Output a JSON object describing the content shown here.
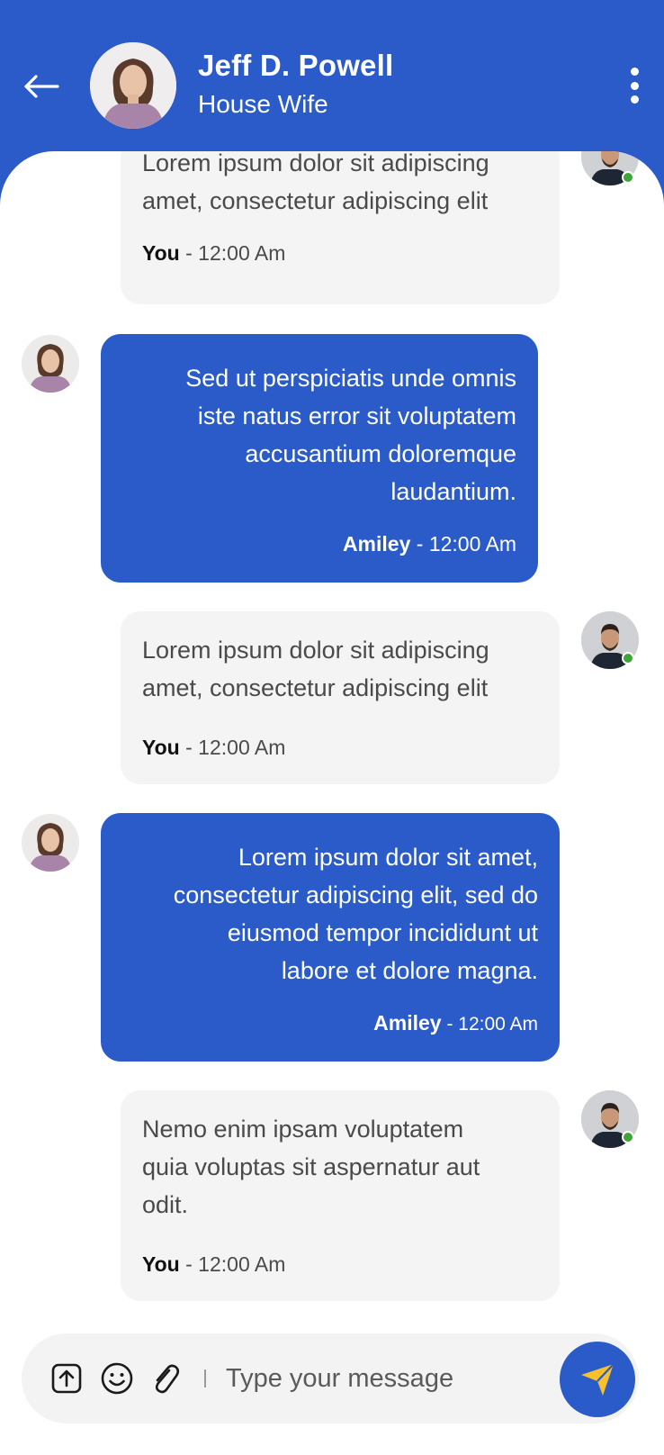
{
  "header": {
    "back_icon": "arrow-left-icon",
    "name": "Jeff D. Powell",
    "status": "House Wife",
    "menu_icon": "more-vertical-icon",
    "background_color": "#2a5bc8"
  },
  "messages": [
    {
      "direction": "incoming",
      "text_lines": [
        "Lorem ipsum dolor sit adipiscing",
        "amet, consectetur adipiscing elit"
      ],
      "sender": "You",
      "time": "- 12:00 Am"
    },
    {
      "direction": "outgoing",
      "text_lines": [
        "Sed ut perspiciatis unde omnis",
        "iste natus error sit voluptatem",
        "accusantium doloremque",
        "laudantium."
      ],
      "sender": "Amiley",
      "time": "- 12:00 Am"
    },
    {
      "direction": "incoming",
      "text_lines": [
        "Lorem ipsum dolor sit adipiscing",
        "amet, consectetur adipiscing elit"
      ],
      "sender": "You",
      "time": "- 12:00 Am"
    },
    {
      "direction": "outgoing",
      "text_lines": [
        "Lorem ipsum dolor sit amet,",
        "consectetur adipiscing elit, sed do",
        "eiusmod tempor incididunt ut",
        "labore et dolore magna."
      ],
      "sender": "Amiley",
      "time": "- 12:00 Am"
    },
    {
      "direction": "incoming",
      "text_lines": [
        "Nemo enim ipsam voluptatem",
        "quia voluptas sit aspernatur aut",
        "odit."
      ],
      "sender": "You",
      "time": "- 12:00 Am"
    }
  ],
  "composer": {
    "placeholder": "Type your message",
    "upload_icon": "upload-icon",
    "emoji_icon": "emoji-icon",
    "attach_icon": "paperclip-icon",
    "send_icon": "send-icon",
    "send_arrow_color": "#f6c12c"
  },
  "colors": {
    "accent": "#2a5bc8",
    "incoming_bubble": "#f4f4f4",
    "online": "#3fa53a"
  }
}
